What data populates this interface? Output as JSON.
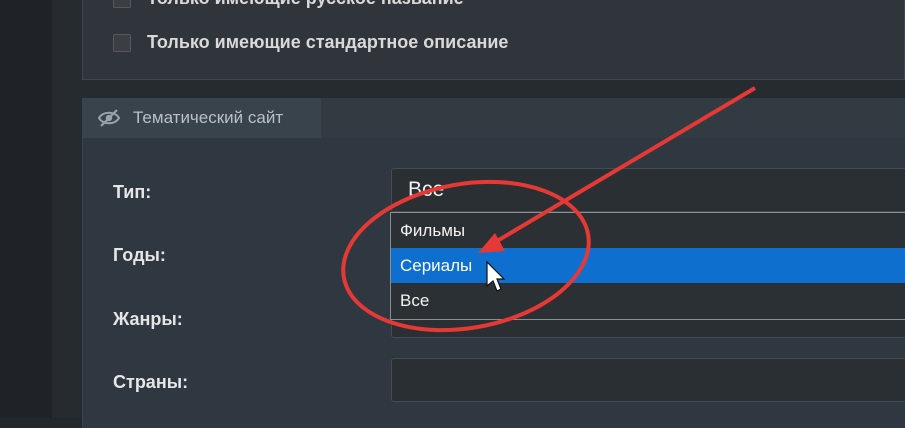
{
  "filters": {
    "checkbox_partial": "Только имеющие русское название",
    "checkbox_standard_desc": "Только имеющие стандартное описание"
  },
  "site_panel": {
    "tab_label": "Тематический сайт",
    "fields": {
      "type_label": "Тип:",
      "years_label": "Годы:",
      "genres_label": "Жанры:",
      "countries_label": "Страны:"
    },
    "type_select": {
      "value": "Все",
      "options": [
        "Фильмы",
        "Сериалы",
        "Все"
      ],
      "highlighted": "Сериалы"
    }
  },
  "colors": {
    "highlight": "#0f6fcf",
    "annotation": "#e53935"
  },
  "icons": {
    "tab_icon": "eye-icon",
    "pointer": "cursor-arrow-icon"
  }
}
